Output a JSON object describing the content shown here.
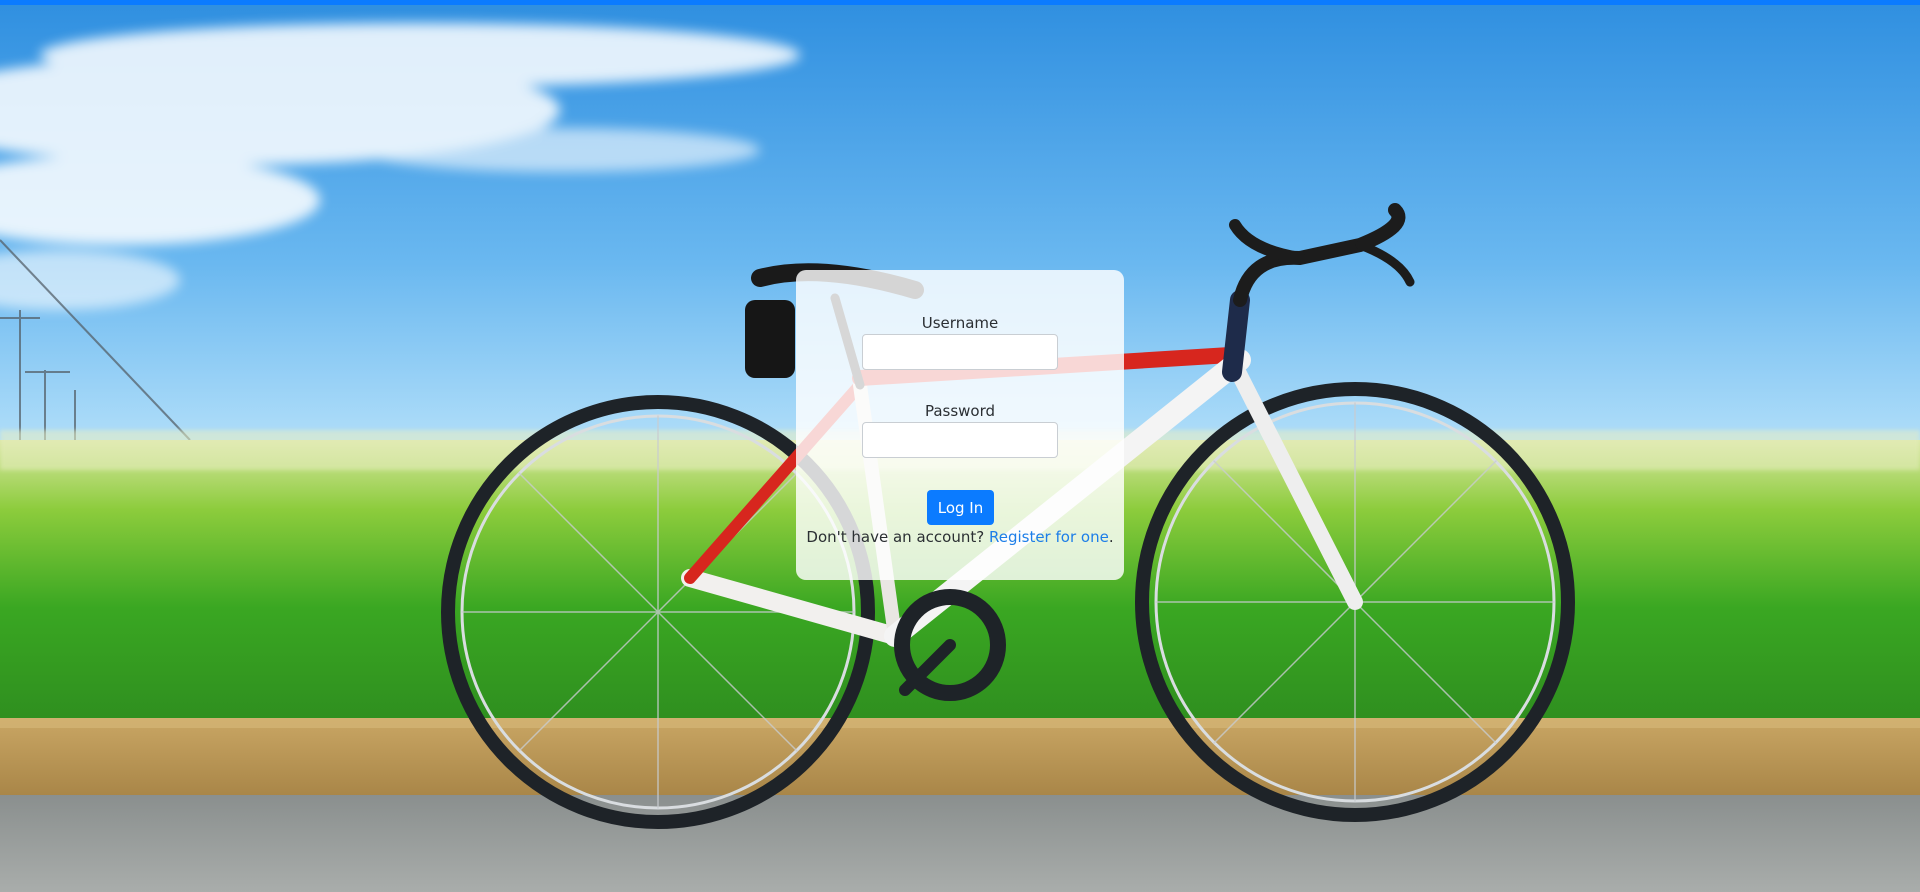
{
  "colors": {
    "accent": "#0b7bff",
    "link": "#1d7ee8"
  },
  "background": {
    "icon": "bicycle-photo"
  },
  "login": {
    "username_label": "Username",
    "username_value": "",
    "password_label": "Password",
    "password_value": "",
    "submit_label": "Log In",
    "register_prompt": "Don't have an account?",
    "register_link": "Register for one",
    "register_suffix": "."
  }
}
